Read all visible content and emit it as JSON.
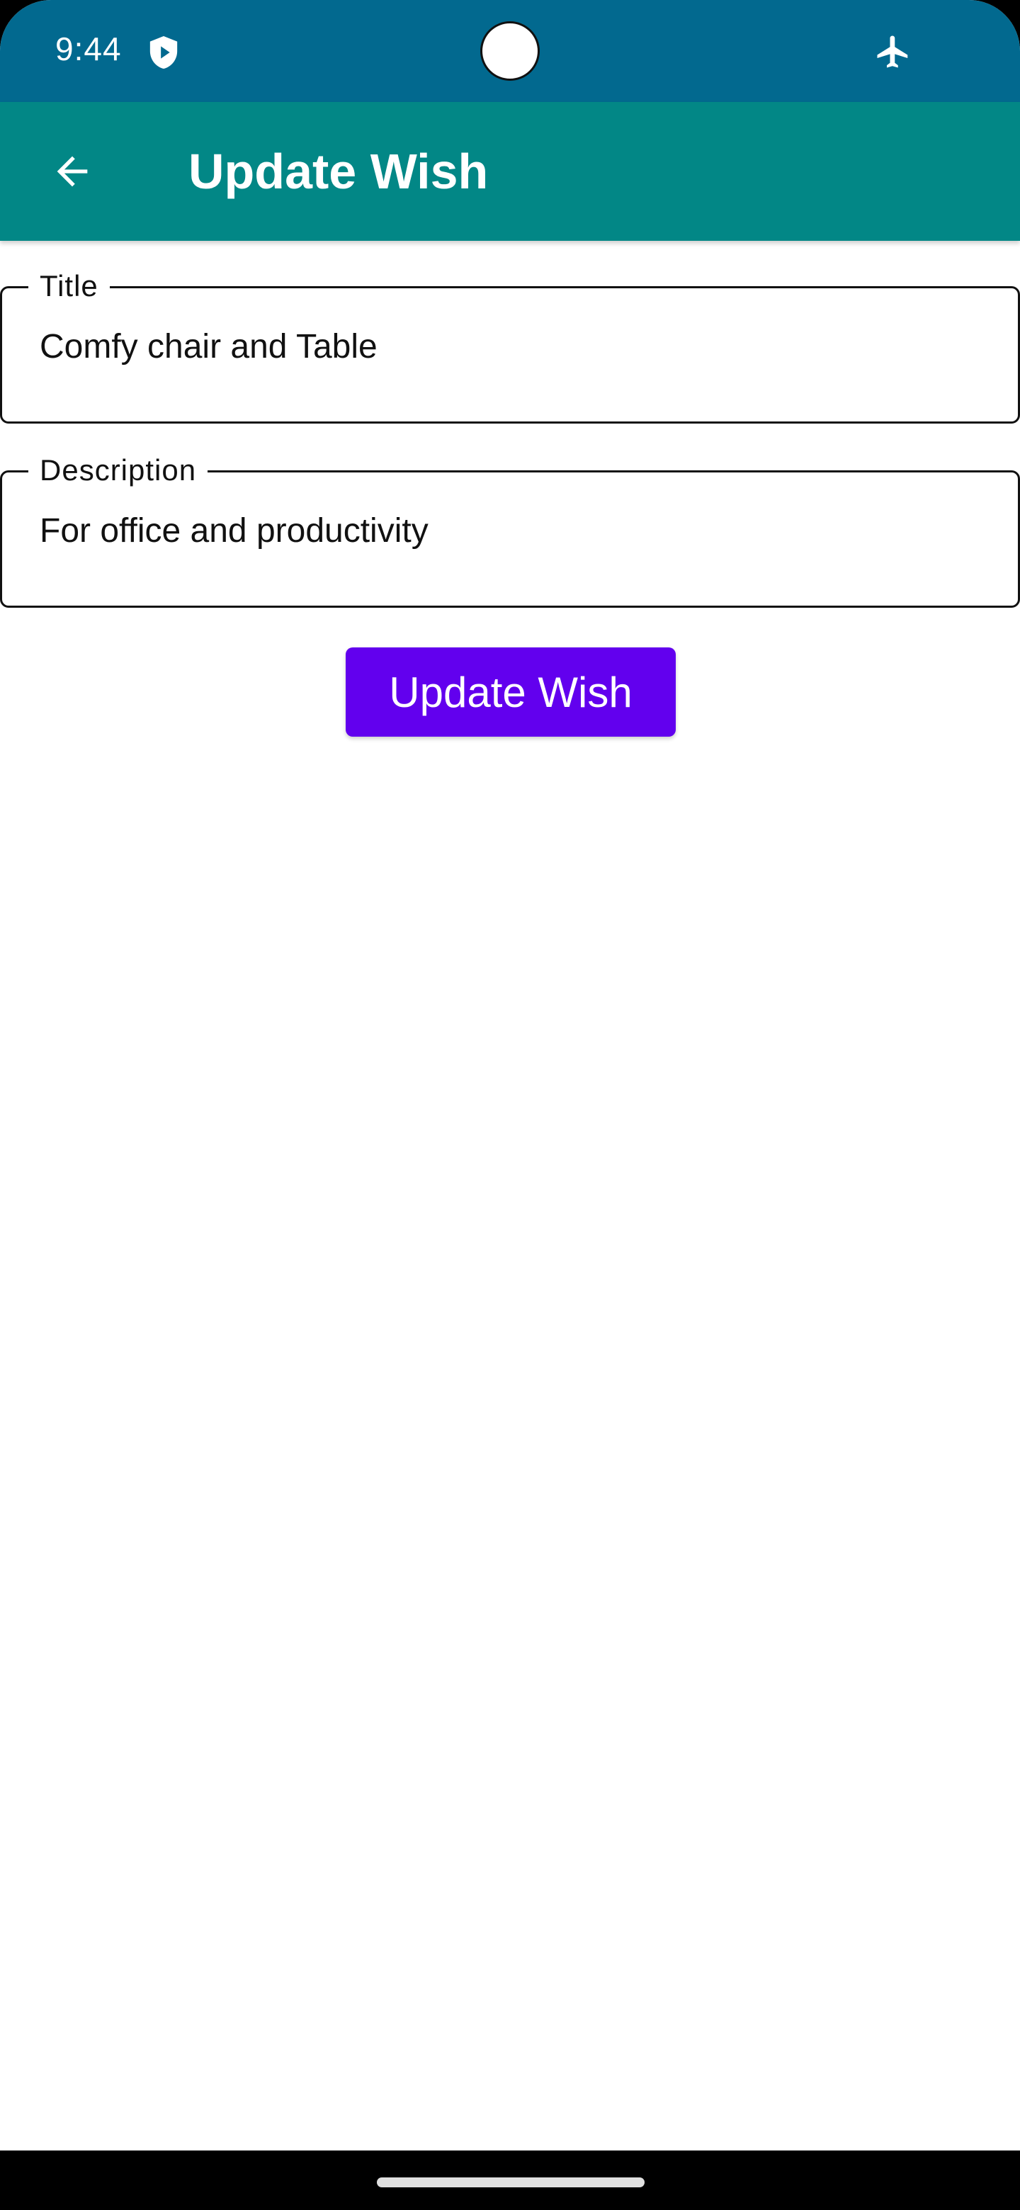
{
  "status_bar": {
    "time": "9:44",
    "background_color": "#02698f",
    "icons": [
      "shield-play-icon",
      "airplane-mode-icon"
    ]
  },
  "app_bar": {
    "title": "Update Wish",
    "back_icon": "arrow-back-icon",
    "background_color": "#028786"
  },
  "form": {
    "title_field": {
      "label": "Title",
      "value": "Comfy chair and Table"
    },
    "description_field": {
      "label": "Description",
      "value": "For office and productivity"
    },
    "submit_button": {
      "label": "Update Wish",
      "color": "#6200ee"
    }
  }
}
